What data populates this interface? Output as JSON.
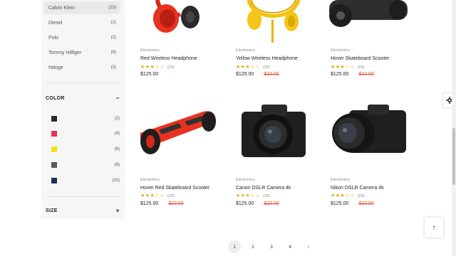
{
  "brands": [
    {
      "name": "Calvin Klein",
      "count": "(23)",
      "active": true
    },
    {
      "name": "Diesel",
      "count": "(2)"
    },
    {
      "name": "Polo",
      "count": "(2)"
    },
    {
      "name": "Tommy Hilfiger",
      "count": "(8)"
    },
    {
      "name": "Ndoge",
      "count": "(3)"
    }
  ],
  "color_section": {
    "title": "COLOR",
    "toggle": "−"
  },
  "colors": [
    {
      "hex": "#2b2b2b",
      "count": "(2)"
    },
    {
      "hex": "#e8305a",
      "count": "(4)"
    },
    {
      "hex": "#f5e21a",
      "count": "(6)"
    },
    {
      "hex": "#5a5a5a",
      "count": "(8)"
    },
    {
      "hex": "#1f2f5c",
      "count": "(10)"
    }
  ],
  "size_section": {
    "title": "SIZE",
    "toggle": "+"
  },
  "products": [
    {
      "category": "Electronics",
      "name": "Red Wireless Headphone",
      "stars": "★★★☆☆",
      "rating": 2.5,
      "reviews": "(23)",
      "price": "$125.00",
      "old_price": ""
    },
    {
      "category": "Electronics",
      "name": "Yellow Wireless Headphone",
      "stars": "★★★☆☆",
      "rating": 2.5,
      "reviews": "(23)",
      "price": "$125.00",
      "old_price": "$22.00"
    },
    {
      "category": "Electronics",
      "name": "Hover Skateboard Scooter",
      "stars": "★★★☆☆",
      "rating": 2.5,
      "reviews": "(23)",
      "price": "$125.00",
      "old_price": "$22.00"
    },
    {
      "category": "Electronics",
      "name": "Hover Red Skateboard Scooter",
      "stars": "★★★☆☆",
      "rating": 2.5,
      "reviews": "(23)",
      "price": "$125.00",
      "old_price": "$22.00"
    },
    {
      "category": "Electronics",
      "name": "Canon DSLR Camera 4k",
      "stars": "★★★☆☆",
      "rating": 2.5,
      "reviews": "(23)",
      "price": "$125.00",
      "old_price": "$22.00"
    },
    {
      "category": "Electronics",
      "name": "Nikon DSLR Camera 4k",
      "stars": "★★★☆☆",
      "rating": 2.5,
      "reviews": "(23)",
      "price": "$125.00",
      "old_price": "$22.00"
    }
  ],
  "pagination": {
    "pages": [
      "1",
      "2",
      "3",
      "4"
    ],
    "current": "1",
    "next": "›"
  },
  "back_to_top": "↑"
}
